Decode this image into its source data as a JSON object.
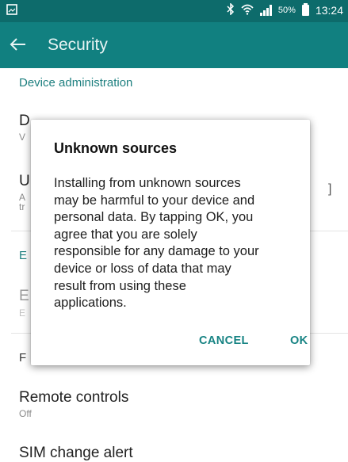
{
  "status_bar": {
    "battery": "50%",
    "time": "13:24",
    "icons": [
      "screenshot-icon",
      "bluetooth-icon",
      "wifi-icon",
      "signal-icon",
      "battery-icon"
    ]
  },
  "app_bar": {
    "title": "Security",
    "back_icon": "back-arrow-icon"
  },
  "settings": {
    "section_device_admin": "Device administration",
    "remote_controls": {
      "title": "Remote controls",
      "value": "Off"
    },
    "sim_change_alert": {
      "title": "SIM change alert"
    },
    "partial_letters": [
      "D",
      "V",
      "U",
      "A",
      "tr",
      "E",
      "E",
      "E",
      "F",
      "]"
    ]
  },
  "dialog": {
    "title": "Unknown sources",
    "message_lines": [
      "Installing from unknown sources",
      "may be harmful to your device and",
      "personal data. By tapping OK, you",
      "agree that you are solely",
      "responsible for any damage to your",
      "device or loss of data that may",
      "result from using these",
      "applications."
    ],
    "cancel_label": "CANCEL",
    "ok_label": "OK"
  },
  "colors": {
    "status_bar": "#0d6b6b",
    "app_bar": "#118080",
    "accent": "#1d7f7f"
  }
}
